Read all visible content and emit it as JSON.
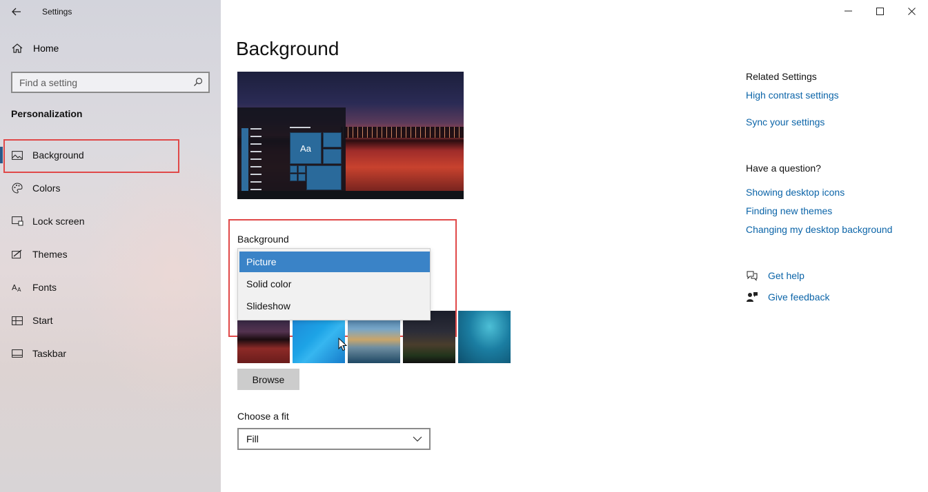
{
  "window": {
    "title": "Settings",
    "controls": {
      "minimize": "—",
      "maximize": "☐",
      "close": "✕"
    }
  },
  "sidebar": {
    "home_label": "Home",
    "search_placeholder": "Find a setting",
    "section_title": "Personalization",
    "items": [
      {
        "label": "Background",
        "icon": "picture-icon"
      },
      {
        "label": "Colors",
        "icon": "palette-icon"
      },
      {
        "label": "Lock screen",
        "icon": "lock-screen-icon"
      },
      {
        "label": "Themes",
        "icon": "brush-icon"
      },
      {
        "label": "Fonts",
        "icon": "font-icon"
      },
      {
        "label": "Start",
        "icon": "start-icon"
      },
      {
        "label": "Taskbar",
        "icon": "taskbar-icon"
      }
    ],
    "selected_index": 0
  },
  "main": {
    "title": "Background",
    "preview_tile_text": "Aa",
    "background_label": "Background",
    "background_options": [
      "Picture",
      "Solid color",
      "Slideshow"
    ],
    "background_selected": "Picture",
    "browse_label": "Browse",
    "fit_label": "Choose a fit",
    "fit_value": "Fill"
  },
  "right": {
    "related_heading": "Related Settings",
    "related_links": [
      "High contrast settings",
      "Sync your settings"
    ],
    "question_heading": "Have a question?",
    "question_links": [
      "Showing desktop icons",
      "Finding new themes",
      "Changing my desktop background"
    ],
    "get_help": "Get help",
    "give_feedback": "Give feedback"
  },
  "colors": {
    "accent": "#0b64a8",
    "selection": "#3a83c7",
    "highlight_annotation": "#e04848"
  }
}
